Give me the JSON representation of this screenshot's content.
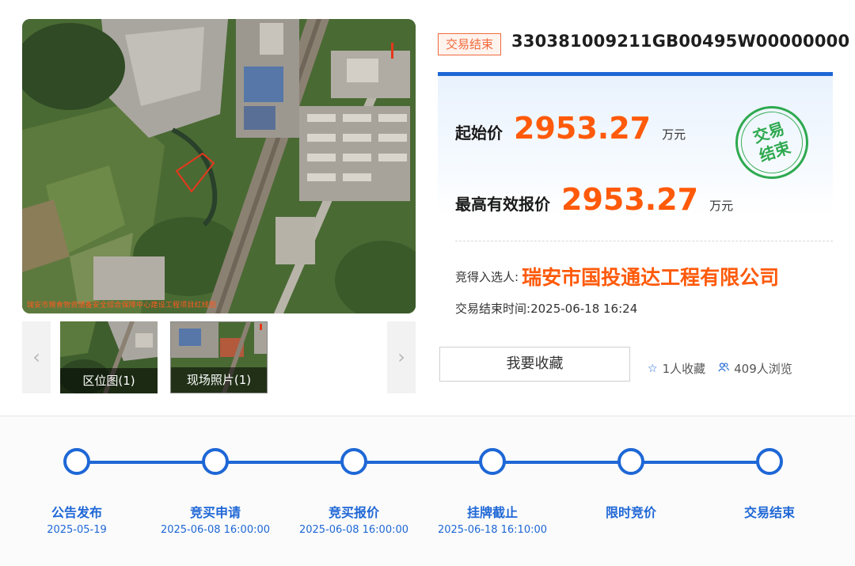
{
  "gallery": {
    "main_caption": "瑞安市粮食物资储备安全综合保障中心建设工程项目红线图",
    "prev_arrow": "‹",
    "next_arrow": "›",
    "thumbnails": [
      {
        "label": "区位图(1)"
      },
      {
        "label": "现场照片(1)"
      }
    ]
  },
  "listing": {
    "status_tag": "交易结束",
    "code": "330381009211GB00495W00000000",
    "start_price": {
      "label": "起始价",
      "value": "2953.27",
      "unit": "万元"
    },
    "highest_bid": {
      "label": "最高有效报价",
      "value": "2953.27",
      "unit": "万元"
    },
    "stamp_text": "交易结束",
    "winner": {
      "label": "竞得入选人:",
      "name": "瑞安市国投通达工程有限公司"
    },
    "end_time": {
      "label": "交易结束时间:",
      "value": "2025-06-18 16:24"
    },
    "favorite_button": "我要收藏",
    "favorites": {
      "count": "1",
      "suffix": "人收藏"
    },
    "views": {
      "count": "409",
      "suffix": "人浏览"
    }
  },
  "timeline": {
    "steps": [
      {
        "label": "公告发布",
        "date": "2025-05-19"
      },
      {
        "label": "竞买申请",
        "date": "2025-06-08 16:00:00"
      },
      {
        "label": "竞买报价",
        "date": "2025-06-08 16:00:00"
      },
      {
        "label": "挂牌截止",
        "date": "2025-06-18 16:10:00"
      },
      {
        "label": "限时竞价",
        "date": ""
      },
      {
        "label": "交易结束",
        "date": ""
      }
    ]
  },
  "colors": {
    "accent_blue": "#1e67d6",
    "price_orange": "#ff5a0a",
    "tag_orange": "#f06a3c",
    "stamp_green": "#2ea94f"
  }
}
